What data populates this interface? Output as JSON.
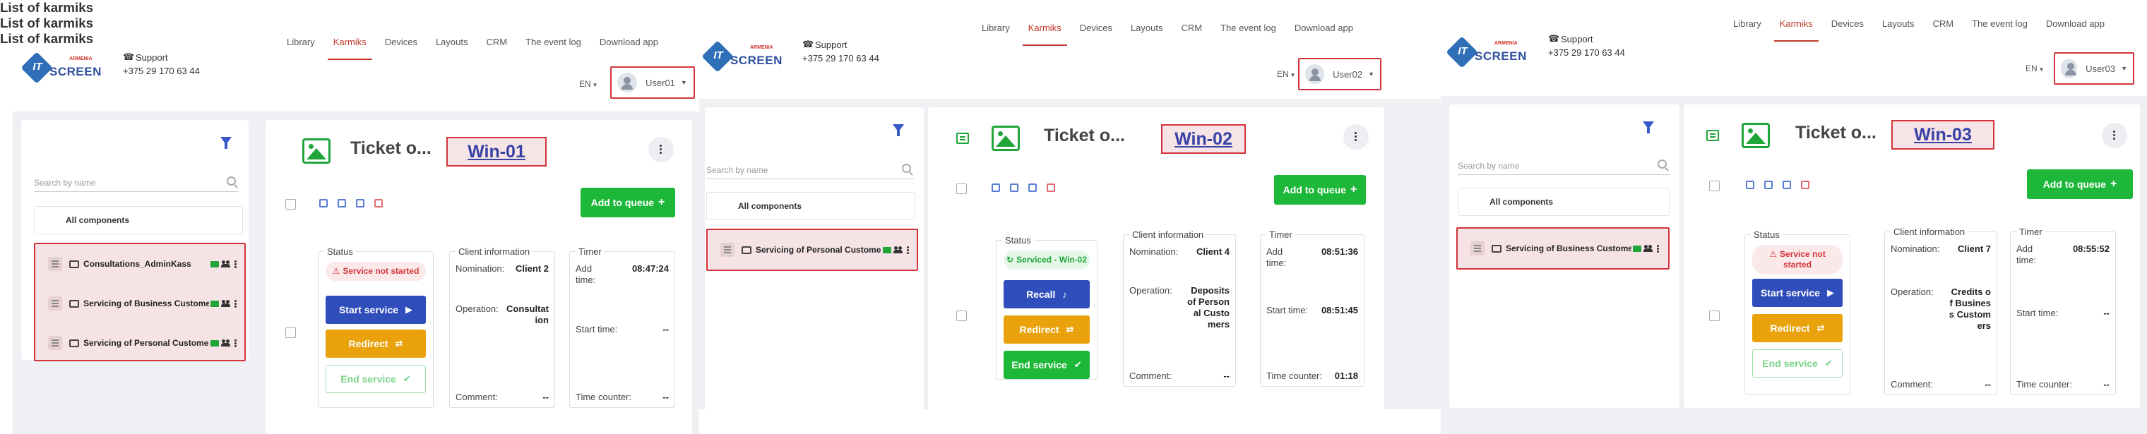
{
  "header": {
    "logo": {
      "brand_it": "IT",
      "brand_screen": "SCREEN",
      "brand_sub": "ARMENIA"
    },
    "support_label": "Support",
    "support_phone": "+375 29 170 63 44",
    "nav": [
      "Library",
      "Karmiks",
      "Devices",
      "Layouts",
      "CRM",
      "The event log",
      "Download app"
    ],
    "active_nav": "Karmiks",
    "language": "EN"
  },
  "list": {
    "title": "List of karmiks",
    "search_placeholder": "Search by name",
    "all_components": "All components"
  },
  "ticket_common": {
    "title": "Ticket o...",
    "add_to_queue": "Add to queue",
    "status_legend": "Status",
    "client_legend": "Client information",
    "timer_legend": "Timer",
    "nomination_label": "Nomination:",
    "operation_label": "Operation:",
    "comment_label": "Comment:",
    "add_time_label": "Add time:",
    "start_time_label": "Start time:",
    "time_counter_label": "Time counter:",
    "start_service": "Start service",
    "redirect": "Redirect",
    "recall": "Recall",
    "end_service": "End service",
    "not_started": "Service not started"
  },
  "panels": [
    {
      "user": "User01",
      "window": "Win-01",
      "items": [
        "Consultations_AdminKass",
        "Servicing of Business Custome",
        "Servicing of Personal Custome"
      ],
      "status": "not_started",
      "client": {
        "nomination": "Client 2",
        "operation": "Consultation",
        "comment": "--"
      },
      "timer": {
        "add_time": "08:47:24",
        "start_time": "--",
        "time_counter": "--"
      }
    },
    {
      "user": "User02",
      "window": "Win-02",
      "items": [
        "Servicing of Personal Custome"
      ],
      "status": "serviced",
      "serviced_text": "Serviced - Win-02",
      "client": {
        "nomination": "Client 4",
        "operation": "Deposits of Personal Customers",
        "comment": "--"
      },
      "timer": {
        "add_time": "08:51:36",
        "start_time": "08:51:45",
        "time_counter": "01:18"
      }
    },
    {
      "user": "User03",
      "window": "Win-03",
      "items": [
        "Servicing of Business Custome"
      ],
      "status": "not_started",
      "client": {
        "nomination": "Client 7",
        "operation": "Credits of Business Customers",
        "comment": "--"
      },
      "timer": {
        "add_time": "08:55:52",
        "start_time": "--",
        "time_counter": "--"
      }
    }
  ],
  "colors": {
    "accent_red": "#d4343a",
    "primary_blue": "#2f4dbb",
    "success_green": "#1db83a",
    "warning_orange": "#e9a20c"
  }
}
